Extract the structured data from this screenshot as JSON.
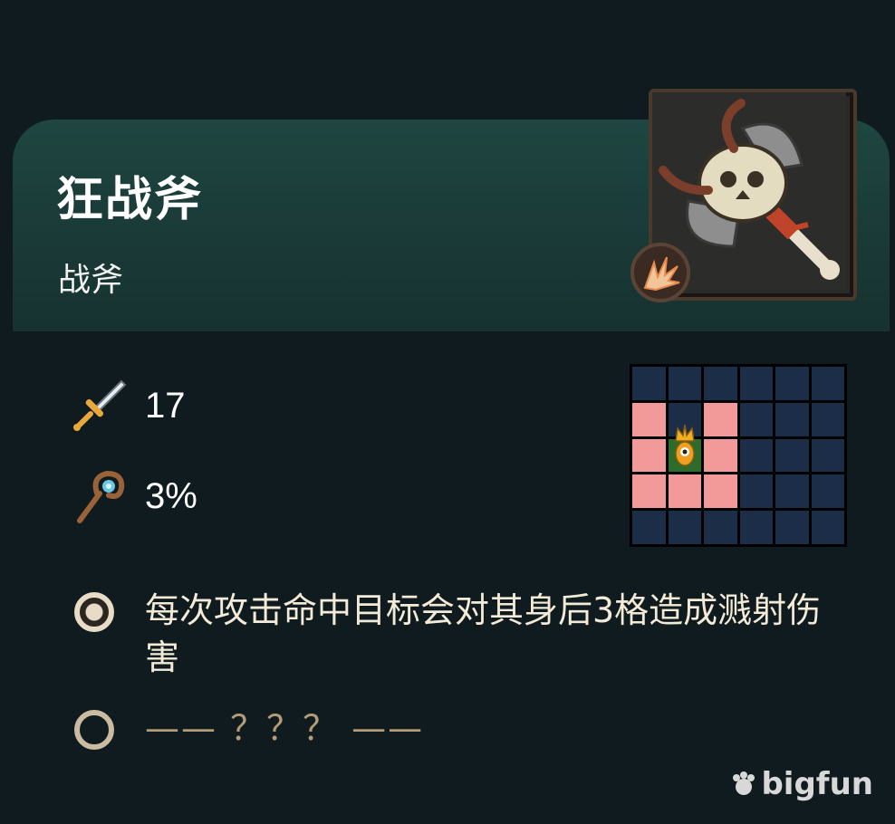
{
  "item": {
    "name": "狂战斧",
    "type": "战斧",
    "portrait_icon": "horned-battle-axe-icon",
    "damage_type_icon": "splash-burst-icon"
  },
  "stats": {
    "attack": {
      "icon": "sword-icon",
      "value": "17"
    },
    "crit": {
      "icon": "staff-icon",
      "value": "3%"
    }
  },
  "range_grid": {
    "cols": 6,
    "rows": 5,
    "hit_cells": [
      [
        1,
        0
      ],
      [
        1,
        2
      ],
      [
        2,
        0
      ],
      [
        2,
        2
      ],
      [
        3,
        0
      ],
      [
        3,
        1
      ],
      [
        3,
        2
      ]
    ],
    "self_cell": [
      2,
      1
    ],
    "colors": {
      "empty": "#1b2d47",
      "hit": "#f29a9a",
      "self": "#2d6b2a"
    }
  },
  "effects": [
    {
      "text": "每次攻击命中目标会对其身后3格造成溅射伤害",
      "unlocked": true
    },
    {
      "text": "—— ？？？ ——",
      "unlocked": false
    }
  ],
  "watermark": "bigfun"
}
